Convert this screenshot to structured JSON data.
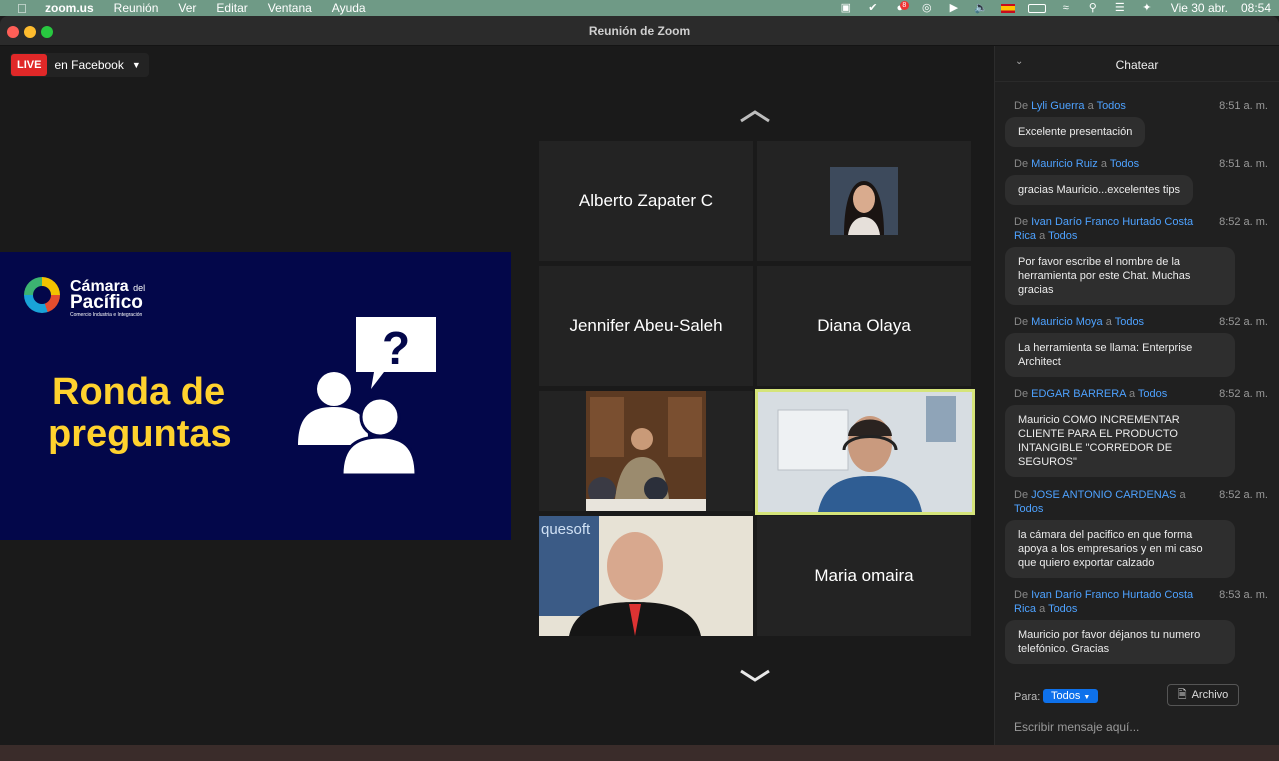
{
  "menubar": {
    "app": "zoom.us",
    "menus": [
      "Reunión",
      "Ver",
      "Editar",
      "Ventana",
      "Ayuda"
    ],
    "date": "Vie 30 abr.",
    "time": "08:54",
    "badge": "8"
  },
  "window": {
    "title": "Reunión de Zoom"
  },
  "live": {
    "badge": "LIVE",
    "label": "en Facebook"
  },
  "slide": {
    "brand_line1": "Cámara",
    "brand_del": "del",
    "brand_line2": "Pacífico",
    "brand_tag": "Comercio Industria e Integración",
    "heading_line1": "Ronda de",
    "heading_line2": "preguntas",
    "icon_glyph": "?"
  },
  "participants": [
    {
      "name": "Alberto Zapater C"
    },
    {
      "name": ""
    },
    {
      "name": "Jennifer Abeu-Saleh"
    },
    {
      "name": "Diana Olaya"
    },
    {
      "name": ""
    },
    {
      "name": ""
    },
    {
      "name": "quesoft"
    },
    {
      "name": "Maria omaira"
    }
  ],
  "chat": {
    "title": "Chatear",
    "from_prefix": "De",
    "to_word": "a",
    "messages": [
      {
        "sender": "Lyli Guerra",
        "to": "Todos",
        "time": "8:51 a. m.",
        "text": "Excelente presentación"
      },
      {
        "sender": "Mauricio Ruiz",
        "to": "Todos",
        "time": "8:51 a. m.",
        "text": "gracias Mauricio...excelentes tips"
      },
      {
        "sender": "Ivan Darío Franco Hurtado Costa Rica",
        "to": "Todos",
        "time": "8:52 a. m.",
        "text": "Por favor escribe el nombre de la herramienta por este Chat. Muchas gracias"
      },
      {
        "sender": "Mauricio Moya",
        "to": "Todos",
        "time": "8:52 a. m.",
        "text": "La herramienta se llama: Enterprise Architect"
      },
      {
        "sender": "EDGAR BARRERA",
        "to": "Todos",
        "time": "8:52 a. m.",
        "text": "Mauricio COMO INCREMENTAR CLIENTE PARA EL PRODUCTO INTANGIBLE \"CORREDOR DE SEGUROS\""
      },
      {
        "sender": "JOSE ANTONIO CARDENAS",
        "to": "Todos",
        "time": "8:52 a. m.",
        "text": "la cámara del pacifico en que forma apoya a los empresarios y en mi caso que quiero exportar calzado"
      },
      {
        "sender": "Ivan Darío Franco Hurtado Costa Rica",
        "to": "Todos",
        "time": "8:53 a. m.",
        "text": "Mauricio por favor déjanos tu numero telefónico. Gracias"
      }
    ],
    "to_label": "Para:",
    "to_value": "Todos",
    "file_button": "Archivo",
    "input_placeholder": "Escribir mensaje aquí..."
  }
}
